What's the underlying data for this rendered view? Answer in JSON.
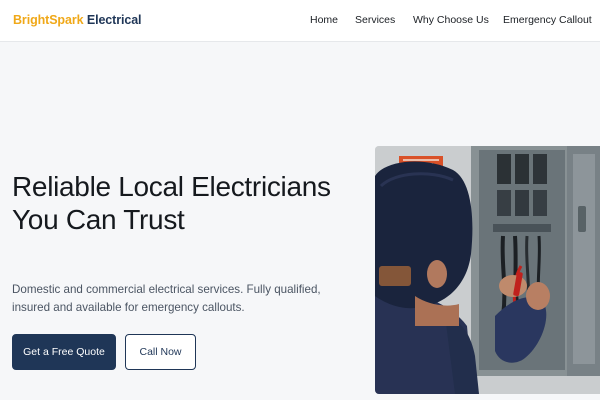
{
  "brand": {
    "name_part1": "BrightSpark",
    "name_part2": "Electrical",
    "accent_color": "#f0a818",
    "primary_color": "#1f3657"
  },
  "nav": {
    "items": [
      {
        "label": "Home"
      },
      {
        "label": "Services"
      },
      {
        "label": "Why Choose Us"
      },
      {
        "label": "Emergency Callout"
      }
    ]
  },
  "hero": {
    "title": "Reliable Local Electricians You Can Trust",
    "subtitle": "Domestic and commercial electrical services. Fully qualified, insured and available for emergency callouts.",
    "primary_button": "Get a Free Quote",
    "secondary_button": "Call Now",
    "image": "electrician-working-on-fuse-box"
  }
}
